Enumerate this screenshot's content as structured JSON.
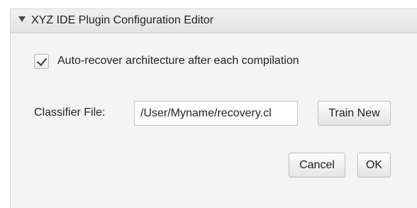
{
  "window": {
    "title": "XYZ IDE Plugin Configuration Editor"
  },
  "options": {
    "auto_recover_label": "Auto-recover architecture after each compilation",
    "auto_recover_checked": true
  },
  "classifier": {
    "label": "Classifier File:",
    "value": "/User/Myname/recovery.cl",
    "train_button_label": "Train New"
  },
  "actions": {
    "cancel_label": "Cancel",
    "ok_label": "OK"
  }
}
